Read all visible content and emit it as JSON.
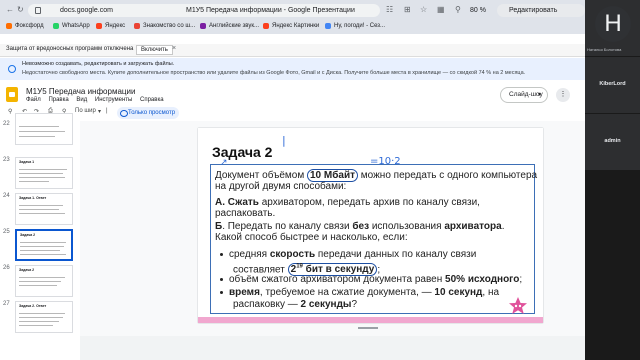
{
  "browser": {
    "url": "docs.google.com",
    "tab_title": "М1У5 Передача информации - Google Презентации",
    "zoom": "80 %",
    "edit_button": "Редактировать"
  },
  "bookmarks": [
    {
      "label": "Фоксфорд",
      "color": "#ff6d00"
    },
    {
      "label": "WhatsApp",
      "color": "#25d366"
    },
    {
      "label": "Яндекс",
      "color": "#fc3f1d"
    },
    {
      "label": "Знакомство со ш...",
      "color": "#ea4335"
    },
    {
      "label": "Английские звук...",
      "color": "#7b1fa2"
    },
    {
      "label": "Яндекс Картинки",
      "color": "#fc3f1d"
    },
    {
      "label": "Ну, погоди! - Сез...",
      "color": "#4285f4"
    }
  ],
  "protection": {
    "text": "Защита от вредоносных программ отключена",
    "button": "Включить",
    "close": "×"
  },
  "storage_banner": {
    "line1": "Невозможно создавать, редактировать и загружать файлы.",
    "line2": "Недостаточно свободного места. Купите дополнительное пространство или удалите файлы из Google Фото, Gmail и с Диска. Получите больше места в хранилище — со скидкой 74 % на 2 месяца."
  },
  "doc": {
    "title": "М1У5 Передача информации",
    "menus": [
      "Файл",
      "Правка",
      "Вид",
      "Инструменты",
      "Справка"
    ],
    "slideshow_button": "Слайд-шоу"
  },
  "toolbar": {
    "fit_label": "По шир",
    "view_mode": "Только просмотр"
  },
  "thumbnails": [
    {
      "num": "22",
      "title": ""
    },
    {
      "num": "23",
      "title": "Задача 1"
    },
    {
      "num": "24",
      "title": "Задача 1. Ответ"
    },
    {
      "num": "25",
      "title": "Задача 2"
    },
    {
      "num": "26",
      "title": "Задача 2"
    },
    {
      "num": "27",
      "title": "Задача 2. Ответ"
    }
  ],
  "slide": {
    "title": "Задача 2",
    "p1_a": "Документ объёмом ",
    "p1_b": "10 Мбайт",
    "p1_c": " можно передать с одного компьютера",
    "p2": "на другой двумя способами:",
    "p3_a": "А. Сжать",
    "p3_b": " архиватором, передать архив по каналу связи,",
    "p4": "распаковать.",
    "p5_a": "Б",
    "p5_b": ". Передать по каналу связи ",
    "p5_c": "без",
    "p5_d": " использования ",
    "p5_e": "архиватора",
    "p5_f": ".",
    "p6": "Какой способ быстрее и насколько, если:",
    "b1_a": "средняя ",
    "b1_b": "скорость",
    "b1_c": " передачи данных по каналу связи",
    "b1_d": "составляет ",
    "b1_e": "2",
    "b1_f": "19",
    "b1_g": " бит в секунду",
    "b1_h": ";",
    "b2_a": "объём сжатого архиватором документа равен ",
    "b2_b": "50% исходного",
    "b2_c": ";",
    "b3_a": "время",
    "b3_b": ", требуемое на сжатие документа, — ",
    "b3_c": "10 секунд",
    "b3_d": ", на",
    "b3_e": "распаковку — ",
    "b3_f": "2 секунды",
    "b3_g": "?",
    "annotation": "=10·2"
  },
  "participants": [
    {
      "initial": "H",
      "name": "Наталья Болотова"
    },
    {
      "name": "KiberLord"
    },
    {
      "name": "admin"
    }
  ]
}
